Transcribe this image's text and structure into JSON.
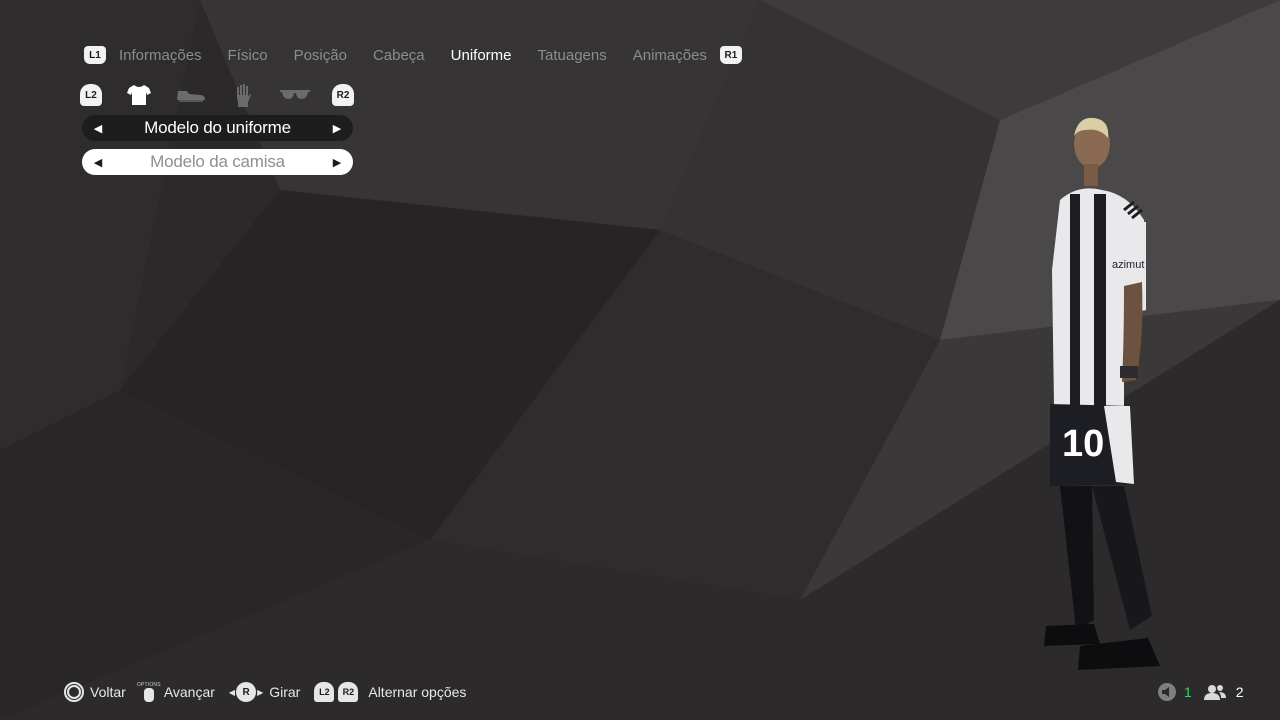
{
  "tabs": {
    "left_shoulder": "L1",
    "right_shoulder": "R1",
    "items": [
      "Informações",
      "Físico",
      "Posição",
      "Cabeça",
      "Uniforme",
      "Tatuagens",
      "Animações"
    ],
    "active": "Uniforme"
  },
  "categories": {
    "left_trigger": "L2",
    "right_trigger": "R2",
    "icons": [
      "shirt-icon",
      "boot-icon",
      "glove-icon",
      "sunglasses-icon"
    ],
    "selected": "shirt-icon"
  },
  "selectors": [
    {
      "value": "Modelo do uniforme",
      "left_arrow": "◀",
      "right_arrow": "▶"
    },
    {
      "value": "Modelo da camisa",
      "left_arrow": "◀",
      "right_arrow": "▶"
    }
  ],
  "player": {
    "sponsor": "azimut",
    "number": "10"
  },
  "hints": {
    "back": "Voltar",
    "options_small": "OPTIONS",
    "advance": "Avançar",
    "stick_button": "R",
    "rotate": "Girar",
    "l2": "L2",
    "r2": "R2",
    "toggle_options": "Alternar opções"
  },
  "status": {
    "mic_count": "1",
    "people_count": "2"
  },
  "colors": {
    "background": "#2a2828",
    "active_tab": "#ffffff",
    "inactive_tab": "#8d8c8c",
    "accent_green": "#3cd16a"
  }
}
